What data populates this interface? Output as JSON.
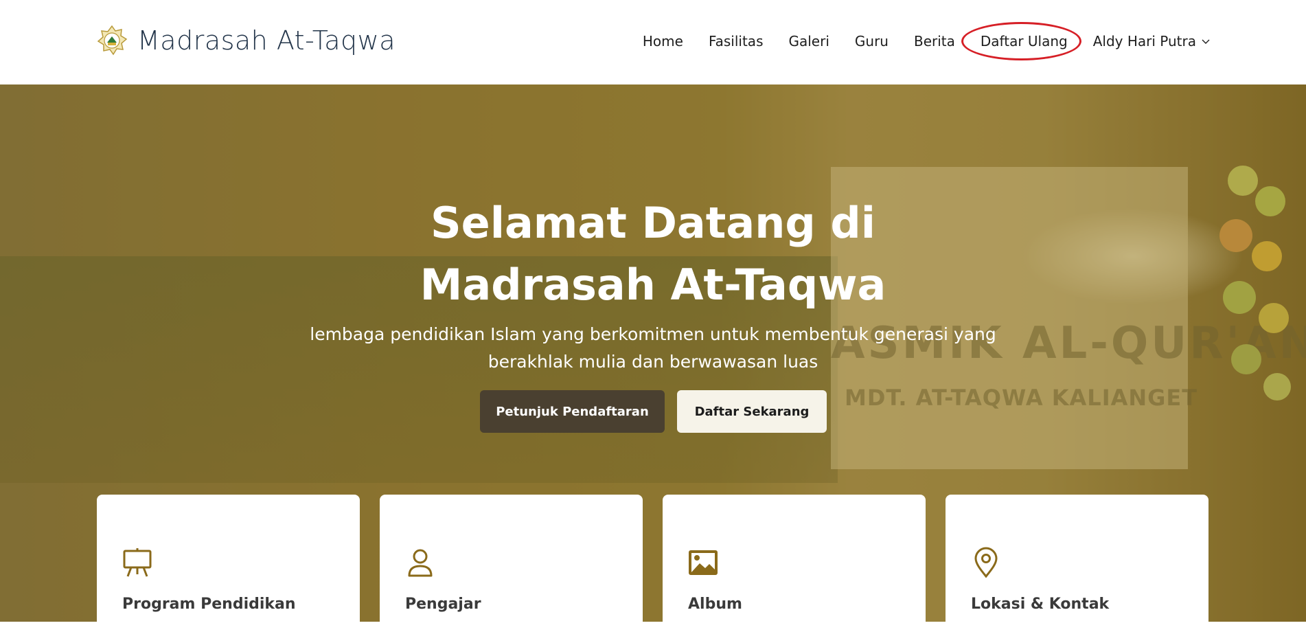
{
  "brand": {
    "name": "Madrasah At-Taqwa",
    "logo_icon": "madrasah-logo-icon"
  },
  "nav": {
    "items": [
      {
        "label": "Home"
      },
      {
        "label": "Fasilitas"
      },
      {
        "label": "Galeri"
      },
      {
        "label": "Guru"
      },
      {
        "label": "Berita"
      },
      {
        "label": "Daftar Ulang"
      }
    ],
    "user": {
      "label": "Aldy Hari Putra",
      "icon": "chevron-down-icon"
    }
  },
  "hero": {
    "title": "Selamat Datang di Madrasah At-Taqwa",
    "subtitle": "lembaga pendidikan Islam yang berkomitmen untuk membentuk generasi yang berakhlak mulia dan berwawasan luas",
    "background_banner_text": "ASMIK AL-QUR'AN",
    "background_banner_sub": "MDT. AT-TAQWA KALIANGET",
    "buttons": {
      "primary": "Petunjuk Pendaftaran",
      "secondary": "Daftar Sekarang"
    }
  },
  "cards": [
    {
      "title": "Program Pendidikan",
      "icon": "presentation-board-icon"
    },
    {
      "title": "Pengajar",
      "icon": "person-icon"
    },
    {
      "title": "Album",
      "icon": "image-icon"
    },
    {
      "title": "Lokasi & Kontak",
      "icon": "location-pin-icon"
    }
  ],
  "colors": {
    "brand_text": "#23354a",
    "accent_gold": "#8a6a1a",
    "button_dark": "#4a4030",
    "button_light": "#f6f3e9",
    "annotation_red": "#d61f26"
  }
}
